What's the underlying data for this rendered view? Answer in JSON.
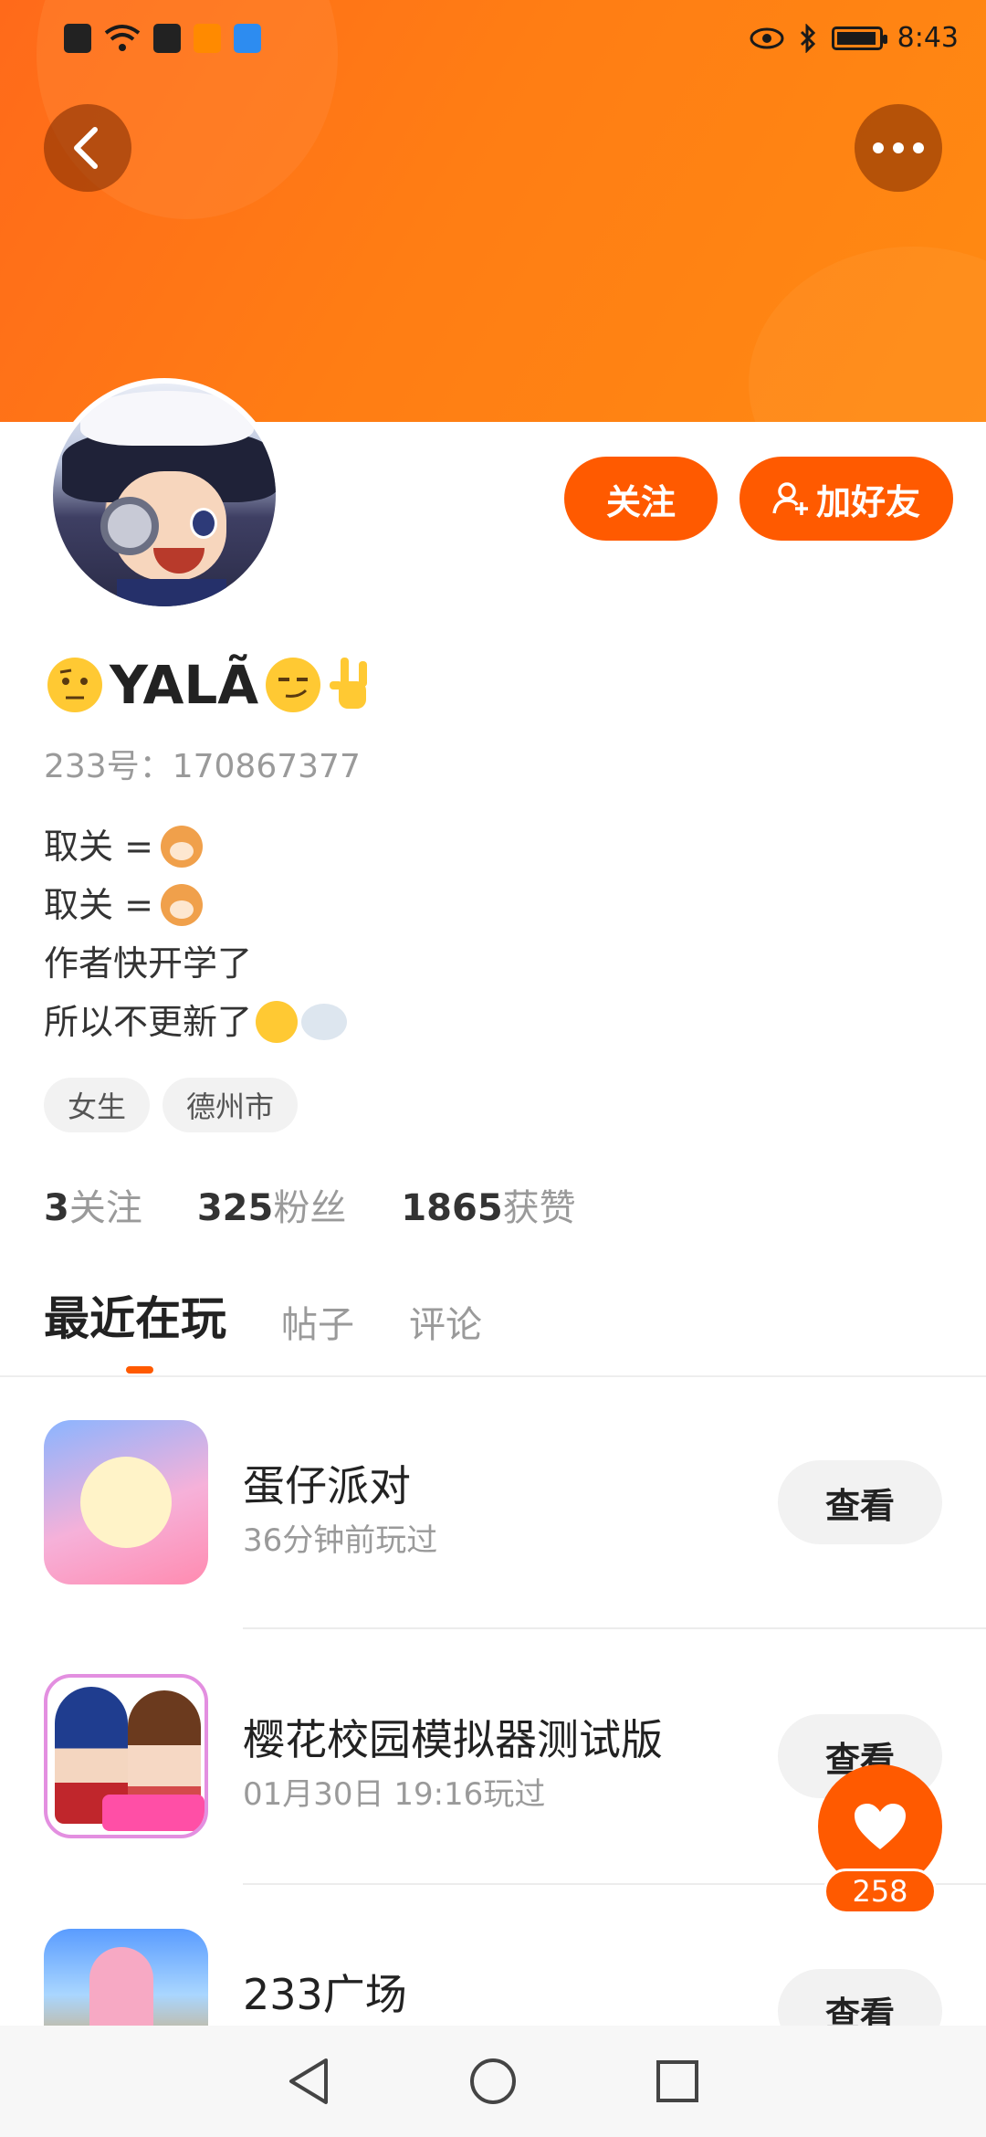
{
  "status_bar": {
    "time": "8:43"
  },
  "header": {
    "back_icon": "back-arrow-icon",
    "more_icon": "more-dots-icon"
  },
  "profile": {
    "name": "YALÃ",
    "uid_text": "233号：170867377",
    "bio_lines": [
      "取关 =",
      "取关 =",
      "作者快开学了",
      "所以不更新了"
    ],
    "tags": [
      "女生",
      "德州市"
    ],
    "follow_label": "关注",
    "add_friend_label": "加好友"
  },
  "stats": [
    {
      "value": "3",
      "label": "关注"
    },
    {
      "value": "325",
      "label": "粉丝"
    },
    {
      "value": "1865",
      "label": "获赞"
    }
  ],
  "tabs": [
    {
      "label": "最近在玩",
      "active": true
    },
    {
      "label": "帖子",
      "active": false
    },
    {
      "label": "评论",
      "active": false
    }
  ],
  "games": [
    {
      "title": "蛋仔派对",
      "subtitle": "36分钟前玩过",
      "button": "查看"
    },
    {
      "title": "樱花校园模拟器测试版",
      "subtitle": "01月30日 19:16玩过",
      "button": "查看"
    },
    {
      "title": "233广场",
      "subtitle": "",
      "button": "查看"
    }
  ],
  "like_fab": {
    "count": "258",
    "icon": "heart-icon"
  },
  "colors": {
    "accent": "#ff5a00",
    "banner": "#ff7d14"
  }
}
